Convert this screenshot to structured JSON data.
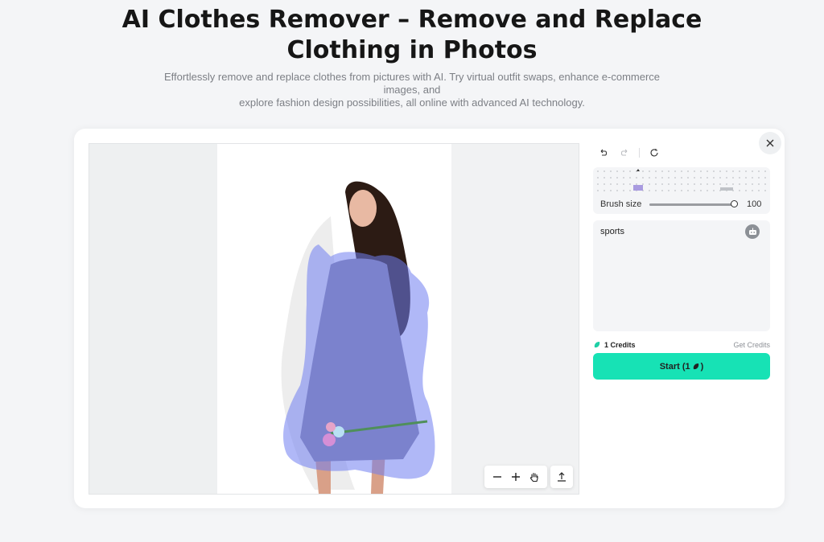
{
  "hero": {
    "title_line1": "AI Clothes Remover – Remove and Replace",
    "title_line2": "Clothing in Photos",
    "subtitle_line1": "Effortlessly remove and replace clothes from pictures with AI. Try virtual outfit swaps, enhance e-commerce images, and",
    "subtitle_line2": "explore fashion design possibilities, all online with advanced AI technology."
  },
  "editor": {
    "brush": {
      "label": "Brush size",
      "value": "100",
      "level": 1.0
    },
    "prompt": {
      "value": "sports",
      "icon": "robot-icon"
    },
    "credits": {
      "label": "1 Credits",
      "link": "Get Credits"
    },
    "start_button": {
      "label": "Start (1",
      "suffix": ")"
    },
    "tools": [
      "undo-icon",
      "redo-icon",
      "reset-icon",
      "zoom-out-icon",
      "zoom-in-icon",
      "hand-icon",
      "upload-icon",
      "close-icon"
    ],
    "colors": {
      "accent": "#17e2b5",
      "mask": "#6f7ef0",
      "credit": "#1ecfa6"
    }
  }
}
